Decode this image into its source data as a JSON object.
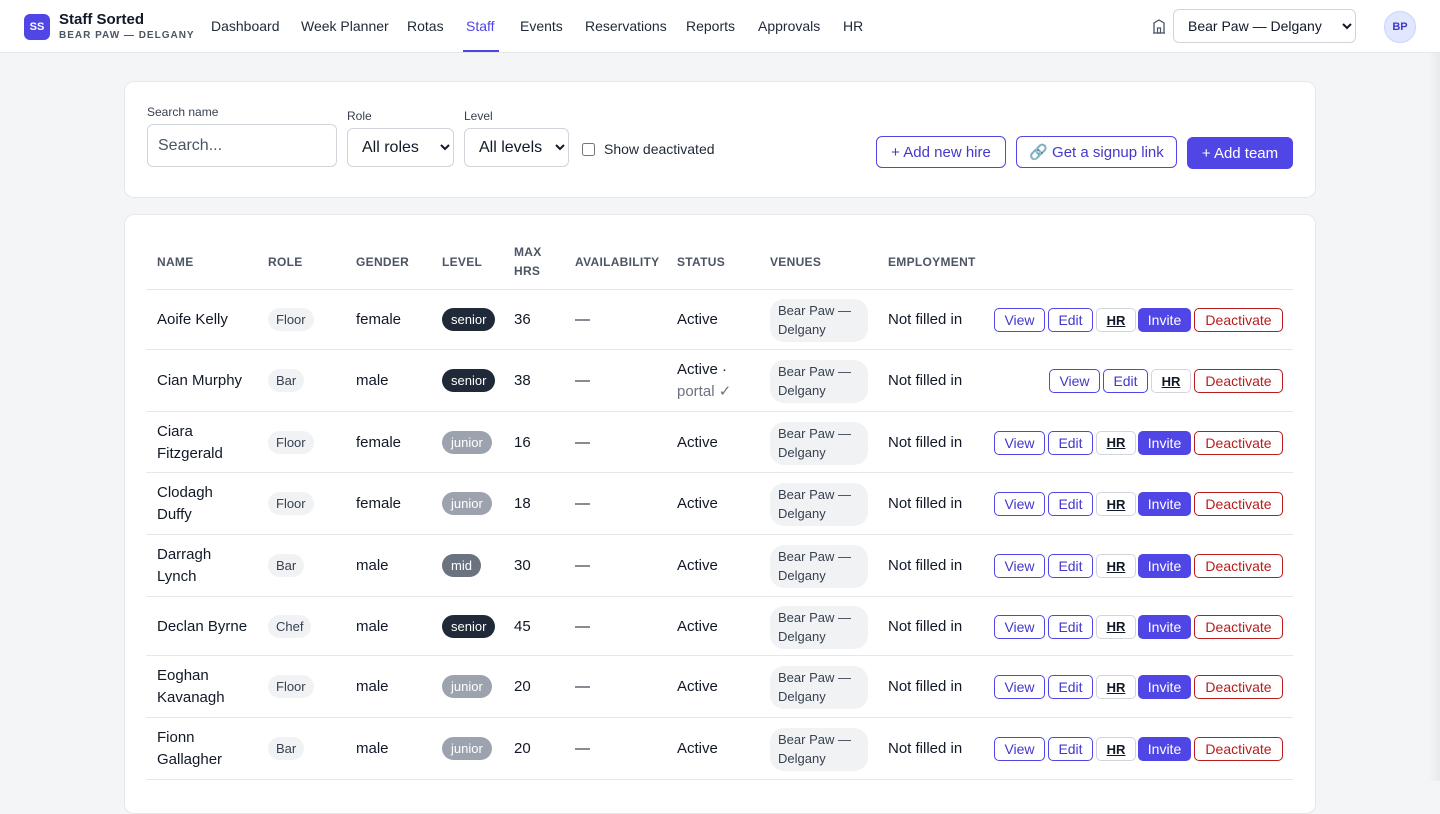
{
  "app": {
    "logo_initials": "SS",
    "name": "Staff Sorted",
    "venue_caption": "BEAR PAW — DELGANY"
  },
  "nav": {
    "items": [
      "Dashboard",
      "Week Planner",
      "Rotas",
      "Staff",
      "Events",
      "Reservations",
      "Reports",
      "Approvals",
      "HR"
    ],
    "active": "Staff"
  },
  "header": {
    "venue_icon": "building-icon",
    "venue_selected": "Bear Paw — Delgany",
    "avatar_initials": "BP"
  },
  "filters": {
    "search_label": "Search name",
    "search_placeholder": "Search...",
    "search_value": "",
    "role_label": "Role",
    "role_selected": "All roles",
    "level_label": "Level",
    "level_selected": "All levels",
    "show_deactivated_label": "Show deactivated",
    "show_deactivated_checked": false,
    "add_new_hire": "+ Add new hire",
    "signup_link": "🔗 Get a signup link",
    "add_team": "+ Add team"
  },
  "table": {
    "headers": {
      "name": "NAME",
      "role": "ROLE",
      "gender": "GENDER",
      "level": "LEVEL",
      "max_hrs_1": "MAX",
      "max_hrs_2": "HRS",
      "availability": "AVAILABILITY",
      "status": "STATUS",
      "venues": "VENUES",
      "employment": "EMPLOYMENT"
    },
    "action_labels": {
      "view": "View",
      "edit": "Edit",
      "hr": "HR",
      "invite": "Invite",
      "deactivate": "Deactivate"
    },
    "venue_line1": "Bear Paw —",
    "venue_line2": "Delgany",
    "rows": [
      {
        "name1": "Aoife Kelly",
        "name2": "",
        "role": "Floor",
        "gender": "female",
        "level": "senior",
        "max_hrs": "36",
        "availability": "—",
        "status1": "Active",
        "status2": "",
        "employment": "Not filled in",
        "invite": true
      },
      {
        "name1": "Cian Murphy",
        "name2": "",
        "role": "Bar",
        "gender": "male",
        "level": "senior",
        "max_hrs": "38",
        "availability": "—",
        "status1": "Active ·",
        "status2": "portal ✓",
        "employment": "Not filled in",
        "invite": false
      },
      {
        "name1": "Ciara",
        "name2": "Fitzgerald",
        "role": "Floor",
        "gender": "female",
        "level": "junior",
        "max_hrs": "16",
        "availability": "—",
        "status1": "Active",
        "status2": "",
        "employment": "Not filled in",
        "invite": true
      },
      {
        "name1": "Clodagh",
        "name2": "Duffy",
        "role": "Floor",
        "gender": "female",
        "level": "junior",
        "max_hrs": "18",
        "availability": "—",
        "status1": "Active",
        "status2": "",
        "employment": "Not filled in",
        "invite": true
      },
      {
        "name1": "Darragh",
        "name2": "Lynch",
        "role": "Bar",
        "gender": "male",
        "level": "mid",
        "max_hrs": "30",
        "availability": "—",
        "status1": "Active",
        "status2": "",
        "employment": "Not filled in",
        "invite": true
      },
      {
        "name1": "Declan Byrne",
        "name2": "",
        "role": "Chef",
        "gender": "male",
        "level": "senior",
        "max_hrs": "45",
        "availability": "—",
        "status1": "Active",
        "status2": "",
        "employment": "Not filled in",
        "invite": true
      },
      {
        "name1": "Eoghan",
        "name2": "Kavanagh",
        "role": "Floor",
        "gender": "male",
        "level": "junior",
        "max_hrs": "20",
        "availability": "—",
        "status1": "Active",
        "status2": "",
        "employment": "Not filled in",
        "invite": true
      },
      {
        "name1": "Fionn",
        "name2": "Gallagher",
        "role": "Bar",
        "gender": "male",
        "level": "junior",
        "max_hrs": "20",
        "availability": "—",
        "status1": "Active",
        "status2": "",
        "employment": "Not filled in",
        "invite": true
      }
    ]
  }
}
